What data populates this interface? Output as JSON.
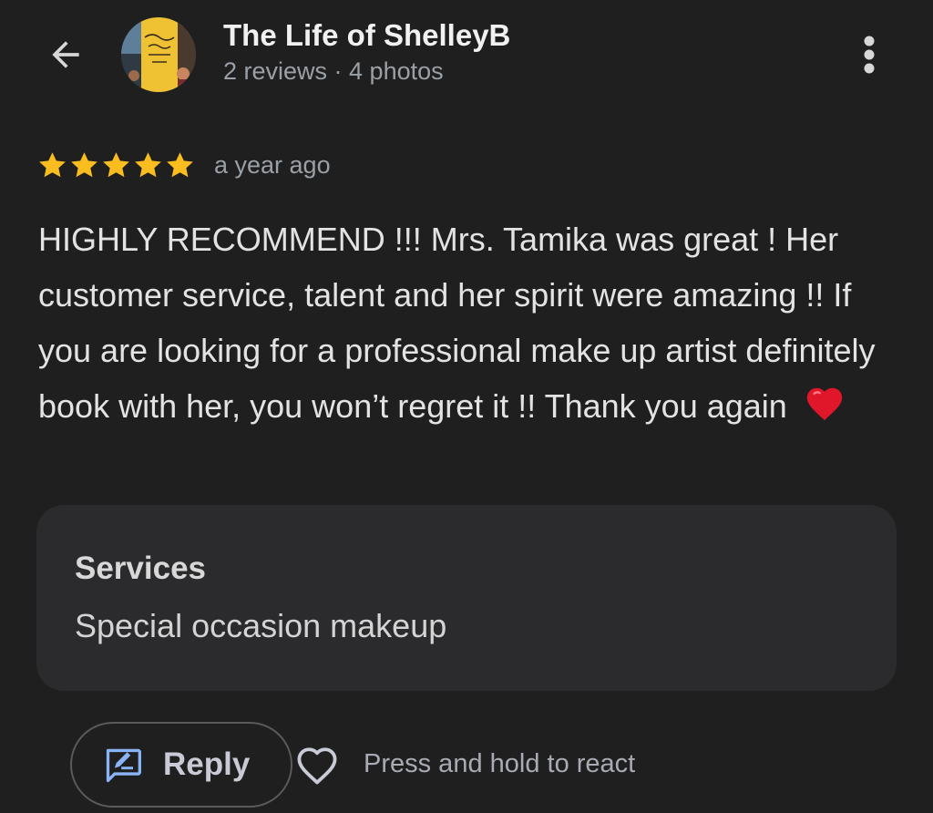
{
  "header": {
    "back_icon": "arrow-back-icon",
    "profile_name": "The Life of ShelleyB",
    "profile_meta": "2 reviews · 4 photos",
    "more_icon": "more-vert-icon"
  },
  "review": {
    "rating": 5,
    "rating_max": 5,
    "star_color": "#f9bd1f",
    "date": "a year ago",
    "text": "HIGHLY RECOMMEND !!! Mrs. Tamika was great ! Her customer service, talent and her spirit were amazing !! If you are looking for a professional make up artist definitely book with her, you won’t regret it !! Thank you again",
    "emoji": "red-heart-emoji"
  },
  "services": {
    "label": "Services",
    "value": "Special occasion makeup"
  },
  "actions": {
    "reply_label": "Reply",
    "reply_icon": "rate-review-icon",
    "react_icon": "heart-outline-icon",
    "react_hint": "Press and hold to react",
    "accent_color": "#8ab4f8"
  }
}
